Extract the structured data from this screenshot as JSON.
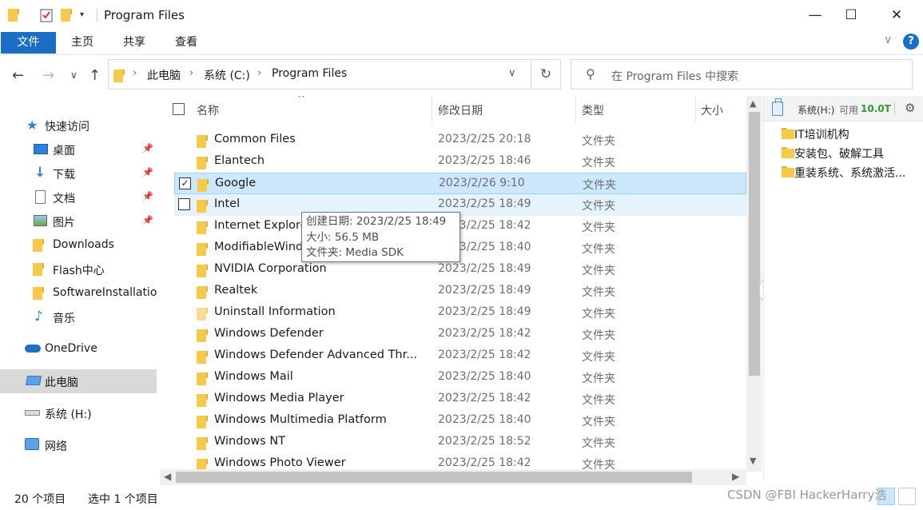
{
  "window": {
    "title": "Program Files",
    "minimize": "—",
    "maximize": "☐",
    "close": "✕"
  },
  "ribbon": {
    "tabs": [
      {
        "label": "文件"
      },
      {
        "label": "主页"
      },
      {
        "label": "共享"
      },
      {
        "label": "查看"
      }
    ],
    "help": "?",
    "collapse": "∨"
  },
  "nav": {
    "back": "←",
    "forward": "→",
    "recent": "∨",
    "up": "↑",
    "breadcrumb": [
      "此电脑",
      "系统 (C:)",
      "Program Files"
    ],
    "refresh": "↻",
    "dropdown": "∨",
    "search_placeholder": "在 Program Files 中搜索"
  },
  "sidebar": {
    "items": [
      {
        "label": "快速访问",
        "icon": "star-icon"
      },
      {
        "label": "桌面",
        "icon": "desktop-icon",
        "pinned": true
      },
      {
        "label": "下载",
        "icon": "download-icon",
        "pinned": true
      },
      {
        "label": "文档",
        "icon": "document-icon",
        "pinned": true
      },
      {
        "label": "图片",
        "icon": "picture-icon",
        "pinned": true
      },
      {
        "label": "Downloads",
        "icon": "folder-icon"
      },
      {
        "label": "Flash中心",
        "icon": "folder-icon"
      },
      {
        "label": "SoftwareInstallatio",
        "icon": "folder-icon"
      },
      {
        "label": "音乐",
        "icon": "music-icon"
      },
      {
        "label": "OneDrive",
        "icon": "cloud-icon"
      },
      {
        "label": "此电脑",
        "icon": "computer-icon",
        "selected": true
      },
      {
        "label": "系统 (H:)",
        "icon": "drive-icon"
      },
      {
        "label": "网络",
        "icon": "network-icon"
      }
    ]
  },
  "columns": {
    "name": "名称",
    "date": "修改日期",
    "type": "类型",
    "size": "大小",
    "sort": "^"
  },
  "files": [
    {
      "name": "Common Files",
      "date": "2023/2/25 20:18",
      "type": "文件夹"
    },
    {
      "name": "Elantech",
      "date": "2023/2/25 18:46",
      "type": "文件夹"
    },
    {
      "name": "Google",
      "date": "2023/2/26 9:10",
      "type": "文件夹",
      "selected": true
    },
    {
      "name": "Intel",
      "date": "2023/2/25 18:49",
      "type": "文件夹",
      "hover": true
    },
    {
      "name": "Internet Explorer",
      "date": "2023/2/25 18:42",
      "type": "文件夹"
    },
    {
      "name": "ModifiableWindowsApps",
      "date": "2023/2/25 18:40",
      "type": "文件夹"
    },
    {
      "name": "NVIDIA Corporation",
      "date": "2023/2/25 18:49",
      "type": "文件夹"
    },
    {
      "name": "Realtek",
      "date": "2023/2/25 18:49",
      "type": "文件夹"
    },
    {
      "name": "Uninstall Information",
      "date": "2023/2/25 18:49",
      "type": "文件夹",
      "pale": true
    },
    {
      "name": "Windows Defender",
      "date": "2023/2/25 18:42",
      "type": "文件夹"
    },
    {
      "name": "Windows Defender Advanced Thr...",
      "date": "2023/2/25 18:42",
      "type": "文件夹"
    },
    {
      "name": "Windows Mail",
      "date": "2023/2/25 18:40",
      "type": "文件夹"
    },
    {
      "name": "Windows Media Player",
      "date": "2023/2/25 18:42",
      "type": "文件夹"
    },
    {
      "name": "Windows Multimedia Platform",
      "date": "2023/2/25 18:40",
      "type": "文件夹"
    },
    {
      "name": "Windows NT",
      "date": "2023/2/25 18:52",
      "type": "文件夹"
    },
    {
      "name": "Windows Photo Viewer",
      "date": "2023/2/25 18:42",
      "type": "文件夹"
    }
  ],
  "tooltip": {
    "created": "创建日期: 2023/2/25 18:49",
    "size": "大小: 56.5 MB",
    "folders": "文件夹: Media SDK"
  },
  "panel": {
    "drive": "系统(H:)",
    "avail_label": "可用",
    "avail_value": "10.0T",
    "items": [
      "IT培训机构",
      "安装包、破解工具",
      "重装系统、系统激活..."
    ]
  },
  "status": {
    "count": "20 个项目",
    "selected": "选中 1 个项目"
  },
  "watermark": "CSDN @FBI HackerHarry浩"
}
